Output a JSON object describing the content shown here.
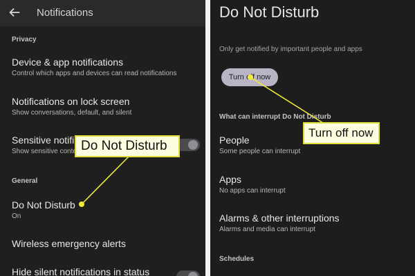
{
  "left": {
    "header": {
      "title": "Notifications"
    },
    "sections": {
      "privacy": "Privacy",
      "general": "General"
    },
    "items": [
      {
        "title": "Device & app notifications",
        "subtitle": "Control which apps and devices can read notifications"
      },
      {
        "title": "Notifications on lock screen",
        "subtitle": "Show conversations, default, and silent"
      },
      {
        "title": "Sensitive notifi",
        "subtitle": "Show sensitive conte"
      },
      {
        "title": "Do Not Disturb",
        "subtitle": "On"
      },
      {
        "title": "Wireless emergency alerts"
      },
      {
        "title": "Hide silent notifications in status"
      }
    ]
  },
  "right": {
    "title": "Do Not Disturb",
    "description": "Only get notified by important people and apps",
    "turn_off_label": "Turn off now",
    "section_interrupt": "What can interrupt Do Not Disturb",
    "section_schedules": "Schedules",
    "items": [
      {
        "title": "People",
        "subtitle": "Some people can interrupt"
      },
      {
        "title": "Apps",
        "subtitle": "No apps can interrupt"
      },
      {
        "title": "Alarms & other interruptions",
        "subtitle": "Alarms and media can interrupt"
      }
    ]
  },
  "callouts": {
    "do_not_disturb": "Do Not Disturb",
    "turn_off_now": "Turn off now"
  },
  "colors": {
    "callout_fill": "#fdfde0",
    "callout_border": "#e0dc3a",
    "button_fill": "#b8b4c6",
    "background": "#1f1f1f"
  }
}
